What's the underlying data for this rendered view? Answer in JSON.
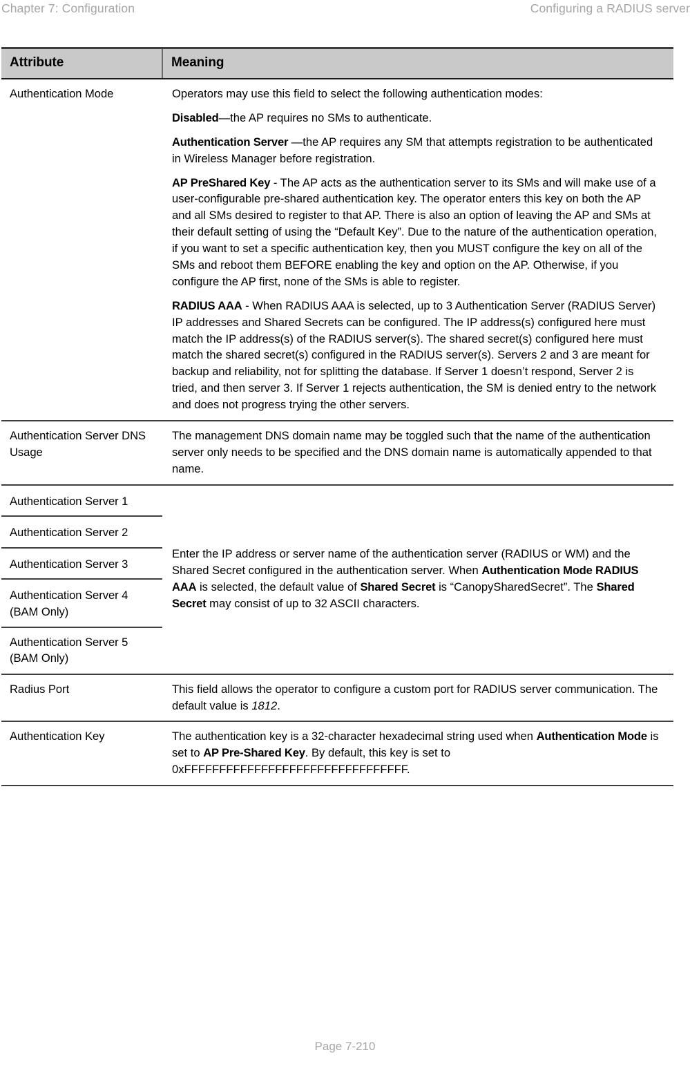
{
  "header": {
    "left": "Chapter 7:  Configuration",
    "right": "Configuring a RADIUS server"
  },
  "table": {
    "columns": {
      "attribute": "Attribute",
      "meaning": "Meaning"
    },
    "rows": [
      {
        "attribute": "Authentication Mode",
        "paragraphs": [
          {
            "text": "Operators may use this field to select the following authentication modes:"
          },
          {
            "bold": "Disabled",
            "text": "—the AP requires no SMs to authenticate."
          },
          {
            "bold": "Authentication Server ",
            "text": "—the AP requires any SM that attempts registration to be authenticated in Wireless Manager before registration."
          },
          {
            "bold": "AP PreShared Key",
            "text": " - The AP acts as the authentication server to its SMs and will make use of a user-configurable pre-shared authentication key. The operator enters this key on both the AP and all SMs desired to register to that AP. There is also an option of leaving the AP and SMs at their default setting of using the “Default Key”. Due to the nature of the authentication operation, if you want to set a specific authentication key, then you MUST configure the key on all of the SMs and reboot them BEFORE enabling the key and option on the AP. Otherwise, if you configure the AP first, none of the SMs is able to register."
          },
          {
            "bold": "RADIUS AAA",
            "text": " - When RADIUS AAA is selected, up to 3 Authentication Server (RADIUS Server) IP addresses and Shared Secrets can be configured. The IP address(s) configured here must match the IP address(s) of the RADIUS server(s). The shared secret(s) configured here must match the shared secret(s) configured in the RADIUS server(s). Servers 2 and 3 are meant for backup and reliability, not for splitting the database. If Server 1 doesn’t respond, Server 2 is tried, and then server 3. If Server 1 rejects authentication, the SM is denied entry to the network and does not progress trying the other servers."
          }
        ]
      },
      {
        "attribute": "Authentication Server DNS Usage",
        "paragraphs": [
          {
            "text": "The management DNS domain name may be toggled such that the name of the authentication server only needs to be specified and the DNS domain name is automatically appended to that name."
          }
        ]
      }
    ],
    "server_group": {
      "attributes": [
        "Authentication Server 1",
        "Authentication Server 2",
        "Authentication Server 3",
        "Authentication Server 4 (BAM Only)",
        "Authentication Server 5 (BAM Only)"
      ],
      "description": {
        "part1": "Enter the IP address or server name of the authentication server (RADIUS or WM) and the Shared Secret configured in the authentication server. When ",
        "bold1": "Authentication Mode RADIUS AAA",
        "part2": " is selected, the default value of ",
        "bold2": "Shared Secret",
        "part3": " is “CanopySharedSecret”. The ",
        "bold3": "Shared Secret",
        "part4": " may consist of up to 32 ASCII characters."
      }
    },
    "tail_rows": [
      {
        "attribute": "Radius Port",
        "part1": "This field allows the operator to configure a custom port for RADIUS server communication. The default value is ",
        "italic": "1812",
        "part2": "."
      },
      {
        "attribute": "Authentication Key",
        "part1": "The authentication key is a 32-character hexadecimal string used when ",
        "bold1": "Authentication Mode",
        "part2": " is set to ",
        "bold2": "AP Pre-Shared Key",
        "part3": ". By default, this key is set to 0xFFFFFFFFFFFFFFFFFFFFFFFFFFFFFFFF."
      }
    ]
  },
  "footer": {
    "page": "Page 7-210"
  }
}
